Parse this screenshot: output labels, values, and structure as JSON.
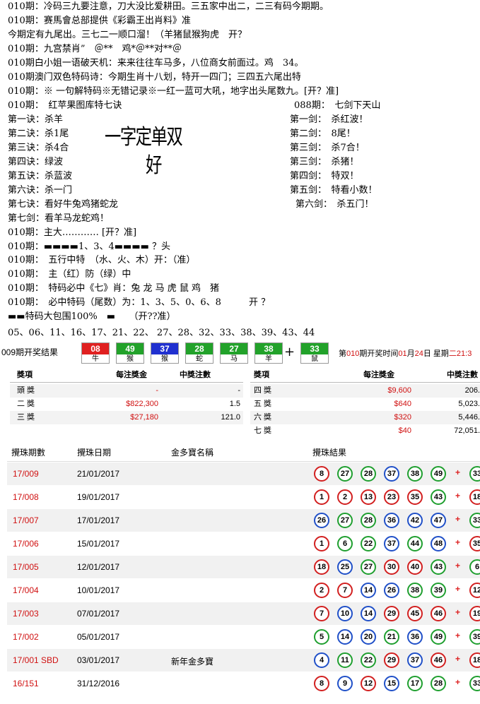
{
  "lines": [
    "010期：冷码三九要注意，刀大没比爱耕田。三五家中出二，二三有码今期期。",
    "010期：赛馬會总部提供《彩霸王出肖料》准",
    "今期定有九尾出。三七二一顺口溜！（羊猪鼠猴狗虎　开？",
    "010期：九宫禁肖”　＠**　鸡*＠**对**＠",
    "010期白小姐一语破天机：来来往往车马多，八位商女前面过。鸡　34。",
    "010期澳门双色特码诗：今期生肖十八划，特开一四门；三四五六尾出特",
    "010期：※ 一句解特码※无错记录※一红一蓝可大吼，地字出头尾数九。[开？准]",
    "010期：　红苹果图库特七诀",
    "088期：　七剑下天山",
    "第一诀：杀羊",
    "第一剑：　杀红波！",
    "第二诀：杀1尾",
    "第二剑：　8尾！",
    "第三诀：杀4合",
    "第三剑：　杀7合！",
    "第四诀：绿波",
    "第三剑：　杀猪！",
    "第五诀：杀蓝波",
    "第四剑：　特双！",
    "第六诀：杀一门",
    "第五剑：　特看小数！",
    "第七诀：看好牛兔鸡猪蛇龙",
    "第六剑：　杀五门！",
    "第七剑：看羊马龙蛇鸡！",
    "010期：主大………… [开？准]",
    "010期：▬▬▬▬1、3、4▬▬▬▬ ？头",
    "010期：　五行中特　（水、火、木）开：（准）",
    "010期：　主（红）防（绿）中",
    "010期：　特码必中《七》肖：兔 龙 马 虎 鼠 鸡　猪",
    "010期：　必中特码（尾数）为：1、3、5、0、6、8　　　开 ？",
    "▬▬特码大包围100%　▬　　（开??准）"
  ],
  "signature_lines": [
    "一字定单双",
    "好"
  ],
  "number_list": "05、06、11、16、17、21、22、 27、28、32、33、38、39、43、44",
  "result_bar": {
    "label": "009期开奖结果",
    "balls": [
      {
        "num": "08",
        "zodiac": "牛",
        "color": "#e02020"
      },
      {
        "num": "49",
        "zodiac": "猴",
        "color": "#22a22a"
      },
      {
        "num": "37",
        "zodiac": "猴",
        "color": "#2030d0"
      },
      {
        "num": "28",
        "zodiac": "蛇",
        "color": "#22a22a"
      },
      {
        "num": "27",
        "zodiac": "马",
        "color": "#22a22a"
      },
      {
        "num": "38",
        "zodiac": "羊",
        "color": "#22a22a"
      },
      {
        "num": "33",
        "zodiac": "鼠",
        "color": "#22a22a"
      }
    ],
    "plus": "+",
    "next_prefix": "第",
    "next_period": "010",
    "next_mid": "期开奖时间",
    "month": "01",
    "month_unit": "月",
    "day": "24",
    "day_unit": "日",
    "weekday_prefix": "星期",
    "weekday": "二",
    "time": "21:3"
  },
  "prize_table": {
    "headers": [
      "獎項",
      "每注獎金",
      "中獎注數",
      "獎項",
      "每注獎金",
      "中獎注數"
    ],
    "left": [
      {
        "name": "頭 獎",
        "amount": "-",
        "count": "-"
      },
      {
        "name": "二 獎",
        "amount": "$822,300",
        "count": "1.5"
      },
      {
        "name": "三 獎",
        "amount": "$27,180",
        "count": "121.0"
      }
    ],
    "right": [
      {
        "name": "四 獎",
        "amount": "$9,600",
        "count": "206."
      },
      {
        "name": "五 獎",
        "amount": "$640",
        "count": "5,023."
      },
      {
        "name": "六 獎",
        "amount": "$320",
        "count": "5,446."
      },
      {
        "name": "七 獎",
        "amount": "$40",
        "count": "72,051."
      }
    ]
  },
  "history": {
    "headers": [
      "攪珠期數",
      "攪珠日期",
      "金多寶名稱",
      "攪珠結果"
    ],
    "rows": [
      {
        "id": "17/009",
        "date": "21/01/2017",
        "name": "",
        "balls": [
          [
            "8",
            "r"
          ],
          [
            "27",
            "g"
          ],
          [
            "28",
            "g"
          ],
          [
            "37",
            "b"
          ],
          [
            "38",
            "g"
          ],
          [
            "49",
            "g"
          ]
        ],
        "extra": [
          "33",
          "g"
        ]
      },
      {
        "id": "17/008",
        "date": "19/01/2017",
        "name": "",
        "balls": [
          [
            "1",
            "r"
          ],
          [
            "2",
            "r"
          ],
          [
            "13",
            "r"
          ],
          [
            "23",
            "r"
          ],
          [
            "35",
            "r"
          ],
          [
            "43",
            "g"
          ]
        ],
        "extra": [
          "18",
          "r"
        ]
      },
      {
        "id": "17/007",
        "date": "17/01/2017",
        "name": "",
        "balls": [
          [
            "26",
            "b"
          ],
          [
            "27",
            "g"
          ],
          [
            "28",
            "g"
          ],
          [
            "36",
            "b"
          ],
          [
            "42",
            "b"
          ],
          [
            "47",
            "b"
          ]
        ],
        "extra": [
          "33",
          "g"
        ]
      },
      {
        "id": "17/006",
        "date": "15/01/2017",
        "name": "",
        "balls": [
          [
            "1",
            "r"
          ],
          [
            "6",
            "g"
          ],
          [
            "22",
            "g"
          ],
          [
            "37",
            "b"
          ],
          [
            "44",
            "g"
          ],
          [
            "48",
            "b"
          ]
        ],
        "extra": [
          "35",
          "r"
        ]
      },
      {
        "id": "17/005",
        "date": "12/01/2017",
        "name": "",
        "balls": [
          [
            "18",
            "r"
          ],
          [
            "25",
            "b"
          ],
          [
            "27",
            "g"
          ],
          [
            "30",
            "r"
          ],
          [
            "40",
            "r"
          ],
          [
            "43",
            "g"
          ]
        ],
        "extra": [
          "6",
          "g"
        ]
      },
      {
        "id": "17/004",
        "date": "10/01/2017",
        "name": "",
        "balls": [
          [
            "2",
            "r"
          ],
          [
            "7",
            "r"
          ],
          [
            "14",
            "b"
          ],
          [
            "26",
            "b"
          ],
          [
            "38",
            "g"
          ],
          [
            "39",
            "g"
          ]
        ],
        "extra": [
          "12",
          "r"
        ]
      },
      {
        "id": "17/003",
        "date": "07/01/2017",
        "name": "",
        "balls": [
          [
            "7",
            "r"
          ],
          [
            "10",
            "b"
          ],
          [
            "14",
            "b"
          ],
          [
            "29",
            "r"
          ],
          [
            "45",
            "r"
          ],
          [
            "46",
            "r"
          ]
        ],
        "extra": [
          "19",
          "r"
        ]
      },
      {
        "id": "17/002",
        "date": "05/01/2017",
        "name": "",
        "balls": [
          [
            "5",
            "g"
          ],
          [
            "14",
            "b"
          ],
          [
            "20",
            "b"
          ],
          [
            "21",
            "g"
          ],
          [
            "36",
            "b"
          ],
          [
            "49",
            "g"
          ]
        ],
        "extra": [
          "39",
          "g"
        ]
      },
      {
        "id": "17/001 SBD",
        "date": "03/01/2017",
        "name": "新年金多寶",
        "balls": [
          [
            "4",
            "b"
          ],
          [
            "11",
            "g"
          ],
          [
            "22",
            "g"
          ],
          [
            "29",
            "r"
          ],
          [
            "37",
            "b"
          ],
          [
            "46",
            "r"
          ]
        ],
        "extra": [
          "18",
          "r"
        ]
      },
      {
        "id": "16/151",
        "date": "31/12/2016",
        "name": "",
        "balls": [
          [
            "8",
            "r"
          ],
          [
            "9",
            "b"
          ],
          [
            "12",
            "r"
          ],
          [
            "15",
            "b"
          ],
          [
            "17",
            "g"
          ],
          [
            "28",
            "g"
          ]
        ],
        "extra": [
          "33",
          "g"
        ]
      }
    ]
  },
  "colors": {
    "red": "#d22020",
    "green": "#1f9f2f",
    "blue": "#2050c8",
    "alt_row": "#f1f1f1"
  }
}
